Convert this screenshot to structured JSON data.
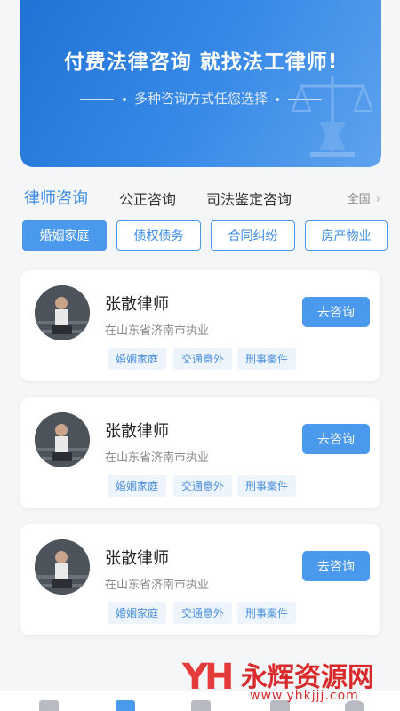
{
  "banner": {
    "title": "付费法律咨询  就找法工律师!",
    "subtitle": "多种咨询方式任您选择"
  },
  "tabs": {
    "items": [
      "律师咨询",
      "公正咨询",
      "司法鉴定咨询"
    ],
    "active_index": 0,
    "region_label": "全国"
  },
  "chips": {
    "items": [
      "婚姻家庭",
      "债权债务",
      "合同纠纷",
      "房产物业"
    ],
    "active_index": 0
  },
  "lawyers": [
    {
      "name": "张散律师",
      "location": "在山东省济南市执业",
      "tags": [
        "婚姻家庭",
        "交通意外",
        "刑事案件"
      ],
      "button": "去咨询"
    },
    {
      "name": "张散律师",
      "location": "在山东省济南市执业",
      "tags": [
        "婚姻家庭",
        "交通意外",
        "刑事案件"
      ],
      "button": "去咨询"
    },
    {
      "name": "张散律师",
      "location": "在山东省济南市执业",
      "tags": [
        "婚姻家庭",
        "交通意外",
        "刑事案件"
      ],
      "button": "去咨询"
    }
  ],
  "watermark": {
    "logo": "YH",
    "title": "永辉资源网",
    "url": "www.yhkjjj.com"
  },
  "colors": {
    "accent": "#4a99ec",
    "banner": "#1f73d4",
    "watermark": "#d82a2a"
  }
}
